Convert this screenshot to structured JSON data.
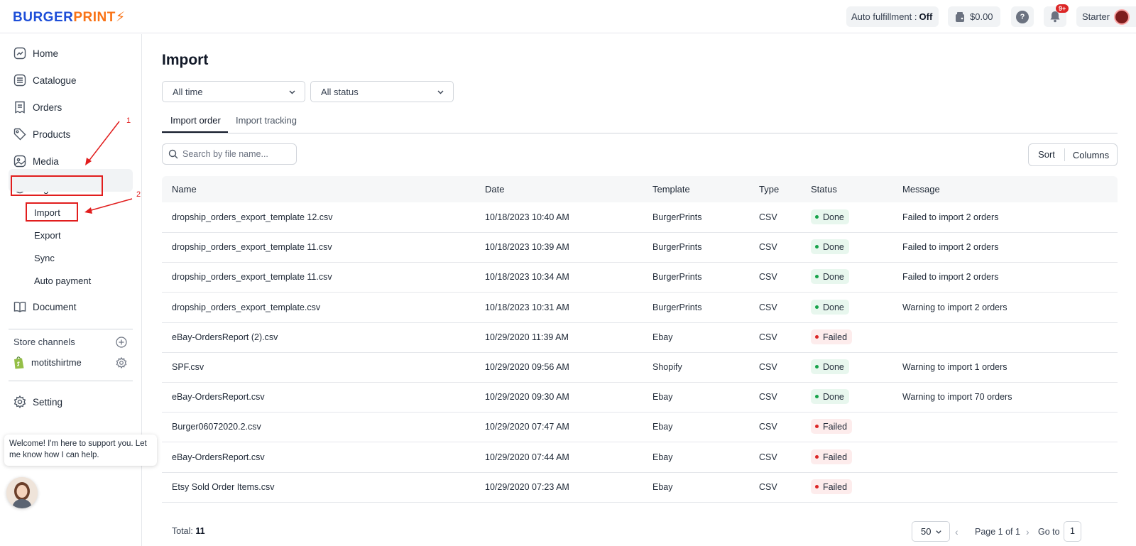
{
  "brand": {
    "part1": "BURGER",
    "part2": "PRINT",
    "bolt": "⚡"
  },
  "topbar": {
    "fulfillment_label": "Auto fulfillment :",
    "fulfillment_value": "Off",
    "balance": "$0.00",
    "notifications_badge": "9+",
    "plan": "Starter"
  },
  "sidebar": {
    "home": "Home",
    "catalogue": "Catalogue",
    "orders": "Orders",
    "products": "Products",
    "media": "Media",
    "logs": "Logs",
    "logs_sub": [
      "Import",
      "Export",
      "Sync",
      "Auto payment"
    ],
    "document": "Document",
    "store_channels": "Store channels",
    "store_name": "motitshirtme",
    "setting": "Setting"
  },
  "annotations": {
    "n1": "1",
    "n2": "2"
  },
  "chat": {
    "message": "Welcome! I'm here to support you. Let me know how I can help."
  },
  "page": {
    "title": "Import",
    "filter_time": "All time",
    "filter_status": "All status",
    "tabs": [
      "Import order",
      "Import tracking"
    ],
    "search_placeholder": "Search by file name...",
    "sort_label": "Sort",
    "columns_label": "Columns"
  },
  "table": {
    "headers": [
      "Name",
      "Date",
      "Template",
      "Type",
      "Status",
      "Message"
    ],
    "rows": [
      {
        "name": "dropship_orders_export_template 12.csv",
        "date": "10/18/2023 10:40 AM",
        "template": "BurgerPrints",
        "type": "CSV",
        "status": "Done",
        "message": "Failed to import 2 orders"
      },
      {
        "name": "dropship_orders_export_template 11.csv",
        "date": "10/18/2023 10:39 AM",
        "template": "BurgerPrints",
        "type": "CSV",
        "status": "Done",
        "message": "Failed to import 2 orders"
      },
      {
        "name": "dropship_orders_export_template 11.csv",
        "date": "10/18/2023 10:34 AM",
        "template": "BurgerPrints",
        "type": "CSV",
        "status": "Done",
        "message": "Failed to import 2 orders"
      },
      {
        "name": "dropship_orders_export_template.csv",
        "date": "10/18/2023 10:31 AM",
        "template": "BurgerPrints",
        "type": "CSV",
        "status": "Done",
        "message": "Warning to import 2 orders"
      },
      {
        "name": "eBay-OrdersReport (2).csv",
        "date": "10/29/2020 11:39 AM",
        "template": "Ebay",
        "type": "CSV",
        "status": "Failed",
        "message": ""
      },
      {
        "name": "SPF.csv",
        "date": "10/29/2020 09:56 AM",
        "template": "Shopify",
        "type": "CSV",
        "status": "Done",
        "message": "Warning to import 1 orders"
      },
      {
        "name": "eBay-OrdersReport.csv",
        "date": "10/29/2020 09:30 AM",
        "template": "Ebay",
        "type": "CSV",
        "status": "Done",
        "message": "Warning to import 70 orders"
      },
      {
        "name": "Burger06072020.2.csv",
        "date": "10/29/2020 07:47 AM",
        "template": "Ebay",
        "type": "CSV",
        "status": "Failed",
        "message": ""
      },
      {
        "name": "eBay-OrdersReport.csv",
        "date": "10/29/2020 07:44 AM",
        "template": "Ebay",
        "type": "CSV",
        "status": "Failed",
        "message": ""
      },
      {
        "name": "Etsy Sold Order Items.csv",
        "date": "10/29/2020 07:23 AM",
        "template": "Ebay",
        "type": "CSV",
        "status": "Failed",
        "message": ""
      }
    ]
  },
  "footer": {
    "total_label": "Total:",
    "total_value": "11",
    "page_size": "50",
    "page_text": "Page 1 of 1",
    "goto_label": "Go to",
    "goto_value": "1"
  }
}
